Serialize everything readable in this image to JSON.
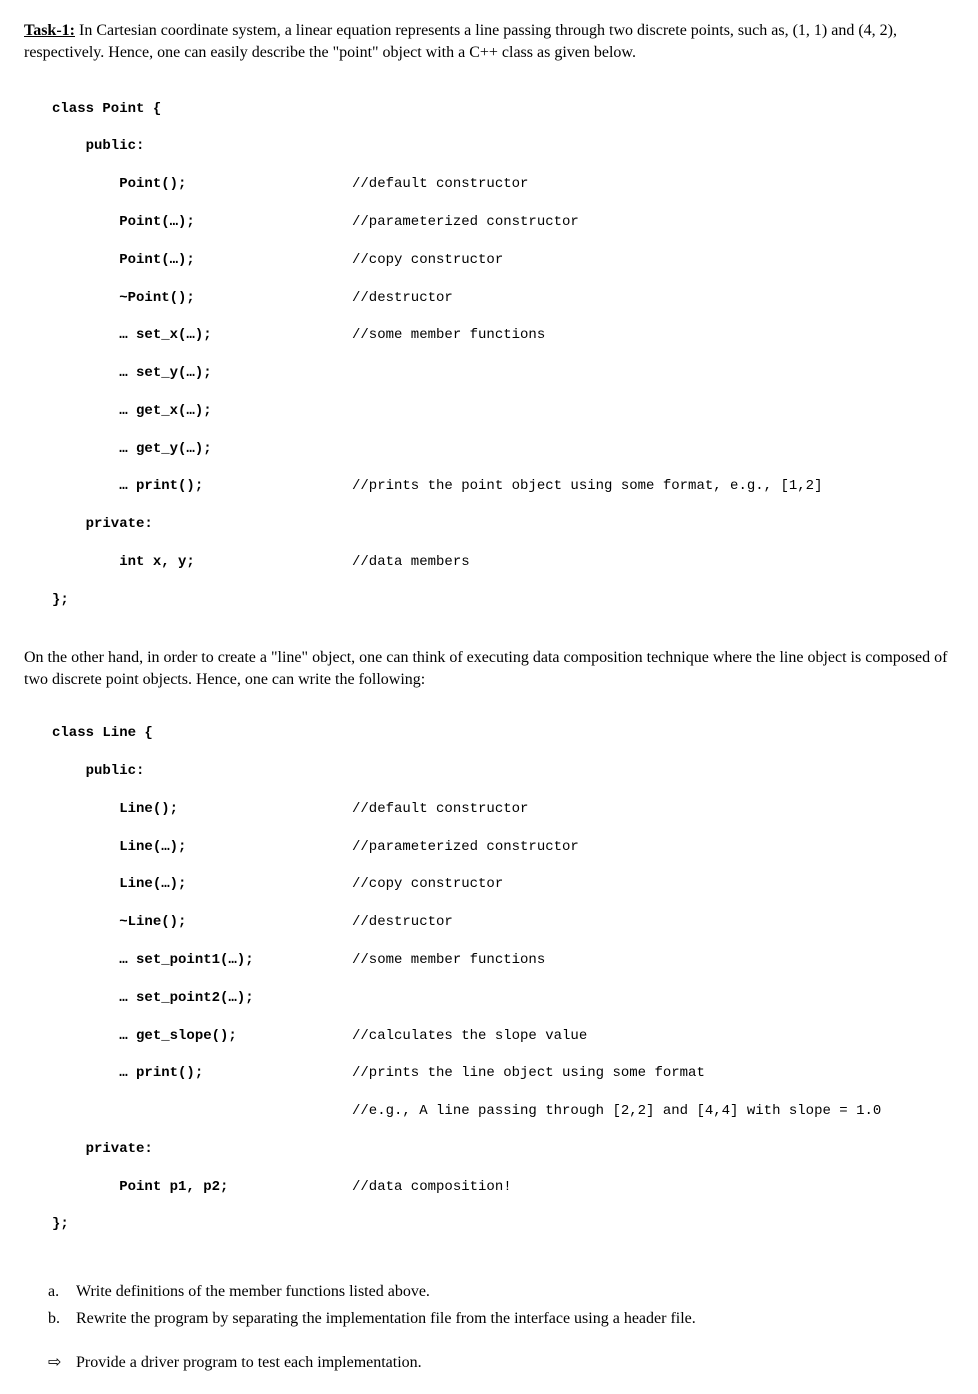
{
  "intro": {
    "task_label": "Task-1:",
    "text": " In Cartesian coordinate system, a linear equation represents a line passing through two discrete points, such as, (1, 1) and (4, 2), respectively. Hence, one can easily describe the \"point\" object with a C++ class as given below."
  },
  "code1": {
    "l0": "class Point {",
    "l1": "    public:",
    "l2a": "        Point();",
    "l2b": "//default constructor",
    "l3a": "        Point(…);",
    "l3b": "//parameterized constructor",
    "l4a": "        Point(…);",
    "l4b": "//copy constructor",
    "l5a": "        ~Point();",
    "l5b": "//destructor",
    "l6a": "        … set_x(…);",
    "l6b": "//some member functions",
    "l7a": "        … set_y(…);",
    "l8a": "        … get_x(…);",
    "l9a": "        … get_y(…);",
    "l10a": "        … print();",
    "l10b": "//prints the point object using some format, e.g., [1,2]",
    "l11": "    private:",
    "l12a": "        int x, y;",
    "l12b": "//data members",
    "l13": "};"
  },
  "mid_para": "On the other hand, in order to create a \"line\" object, one can think of executing data composition technique where the line object is composed of two discrete point objects. Hence, one can write the following:",
  "code2": {
    "l0": "class Line {",
    "l1": "    public:",
    "l2a": "        Line();",
    "l2b": "//default constructor",
    "l3a": "        Line(…);",
    "l3b": "//parameterized constructor",
    "l4a": "        Line(…);",
    "l4b": "//copy constructor",
    "l5a": "        ~Line();",
    "l5b": "//destructor",
    "l6a": "        … set_point1(…);",
    "l6b": "//some member functions",
    "l7a": "        … set_point2(…);",
    "l8a": "        … get_slope();",
    "l8b": "//calculates the slope value",
    "l9a": "        … print();",
    "l9b": "//prints the line object using some format",
    "l10b": "//e.g., A line passing through [2,2] and [4,4] with slope = 1.0",
    "l11": "    private:",
    "l12a": "        Point p1, p2;",
    "l12b": "//data composition!",
    "l13": "};"
  },
  "questions": {
    "a_letter": "a.",
    "a_text": "Write definitions of the member functions listed above.",
    "b_letter": "b.",
    "b_text": "Rewrite the program by separating the implementation file from the interface using a header file."
  },
  "arrow": {
    "symbol": "⇨",
    "text": "Provide a driver program to test each implementation."
  }
}
